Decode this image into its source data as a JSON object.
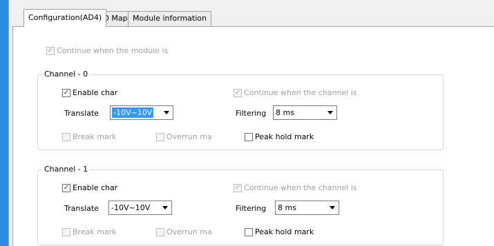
{
  "tabs": [
    {
      "label": "Configuration(AD4)",
      "active": true
    },
    {
      "label": "IO Map",
      "active": false
    },
    {
      "label": "Module information",
      "active": false
    }
  ],
  "module": {
    "continue_label": "Continue when the module is",
    "continue_checked": true
  },
  "channels": [
    {
      "title": "Channel - 0",
      "enable_label": "Enable char",
      "continue_label": "Continue when the channel is",
      "translate_label": "Translate",
      "translate_value": "-10V~10V",
      "filtering_label": "Filtering",
      "filtering_value": "8 ms",
      "break_label": "Break mark",
      "overrun_label": "Overrun ma",
      "peak_label": "Peak hold mark"
    },
    {
      "title": "Channel - 1",
      "enable_label": "Enable char",
      "continue_label": "Continue when the channel is",
      "translate_label": "Translate",
      "translate_value": "-10V~10V",
      "filtering_label": "Filtering",
      "filtering_value": "8 ms",
      "break_label": "Break mark",
      "overrun_label": "Overrun ma",
      "peak_label": "Peak hold mark"
    }
  ],
  "icons": {
    "check": "✓"
  },
  "colors": {
    "window_border": "#2a8ee0",
    "selection": "#3399ff"
  }
}
